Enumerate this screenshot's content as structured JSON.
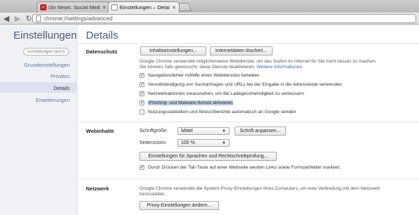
{
  "browser": {
    "tabs": [
      {
        "label": "t3n News: Social Media | Op",
        "favicon_letter": "t3n",
        "active": false
      },
      {
        "label": "Einstellungen – Details",
        "active": true
      }
    ],
    "address": "chrome://settings/advanced"
  },
  "sidebar": {
    "title": "Einstellungen",
    "search_placeholder": "Einstellungen durch",
    "items": [
      {
        "label": "Grundeinstellungen"
      },
      {
        "label": "Privates"
      },
      {
        "label": "Details",
        "active": true
      },
      {
        "label": "Erweiterungen"
      }
    ]
  },
  "main": {
    "title": "Details",
    "datenschutz": {
      "heading": "Datenschutz",
      "btn_content": "Inhaltseinstellungen...",
      "btn_clear": "Internetdaten löschen...",
      "desc_line1": "Google Chrome verwendet möglicherweise Webdienste, um das Surfen im Internet für Sie noch besser zu machen.",
      "desc_line2": "Sie können, falls gewünscht, diese Dienste deaktivieren.",
      "desc_link": "Weitere Informationen",
      "options": [
        {
          "label": "Navigationsfehler mithilfe eines Webdienstes beheben",
          "checked": true
        },
        {
          "label": "Vervollständigung von Suchanfragen und URLs bei der Eingabe in die Adressleiste verwenden",
          "checked": true
        },
        {
          "label": "Netzwerkaktionen voraussehen, um die Ladegeschwindigkeit zu verbessern",
          "checked": true
        },
        {
          "label": "Phishing- und Malware-Schutz aktivieren",
          "checked": true
        },
        {
          "label": "Nutzungsstatistiken und Absturzberichte automatisch an Google senden",
          "checked": false
        }
      ]
    },
    "webinhalte": {
      "heading": "Webinhalte",
      "font_size_label": "Schriftgröße:",
      "font_size_value": "Mittel",
      "font_button": "Schrift anpassen...",
      "zoom_label": "Seitenzoom:",
      "zoom_value": "100 %",
      "lang_button": "Einstellungen für Sprachen und Rechtschreibprüfung...",
      "tab_option": {
        "label": "Durch Drücken der Tab-Taste auf einer Webseite werden Links sowie Formularfelder markiert.",
        "checked": true
      }
    },
    "netzwerk": {
      "heading": "Netzwerk",
      "desc_line1": "Google Chrome verwendet die System-Proxy-Einstellungen Ihres Computers, um eine Verbindung mit dem Netzwerk",
      "desc_line2": "herzustellen.",
      "proxy_button": "Proxy-Einstellungen ändern..."
    }
  },
  "colors": {
    "accent_link": "#3a5fc6",
    "sidebar_bg": "#f0f1f4",
    "sidebar_active": "#dbe1ee",
    "heading_blue": "#4a5a7a",
    "favicon_red": "#d42020"
  }
}
